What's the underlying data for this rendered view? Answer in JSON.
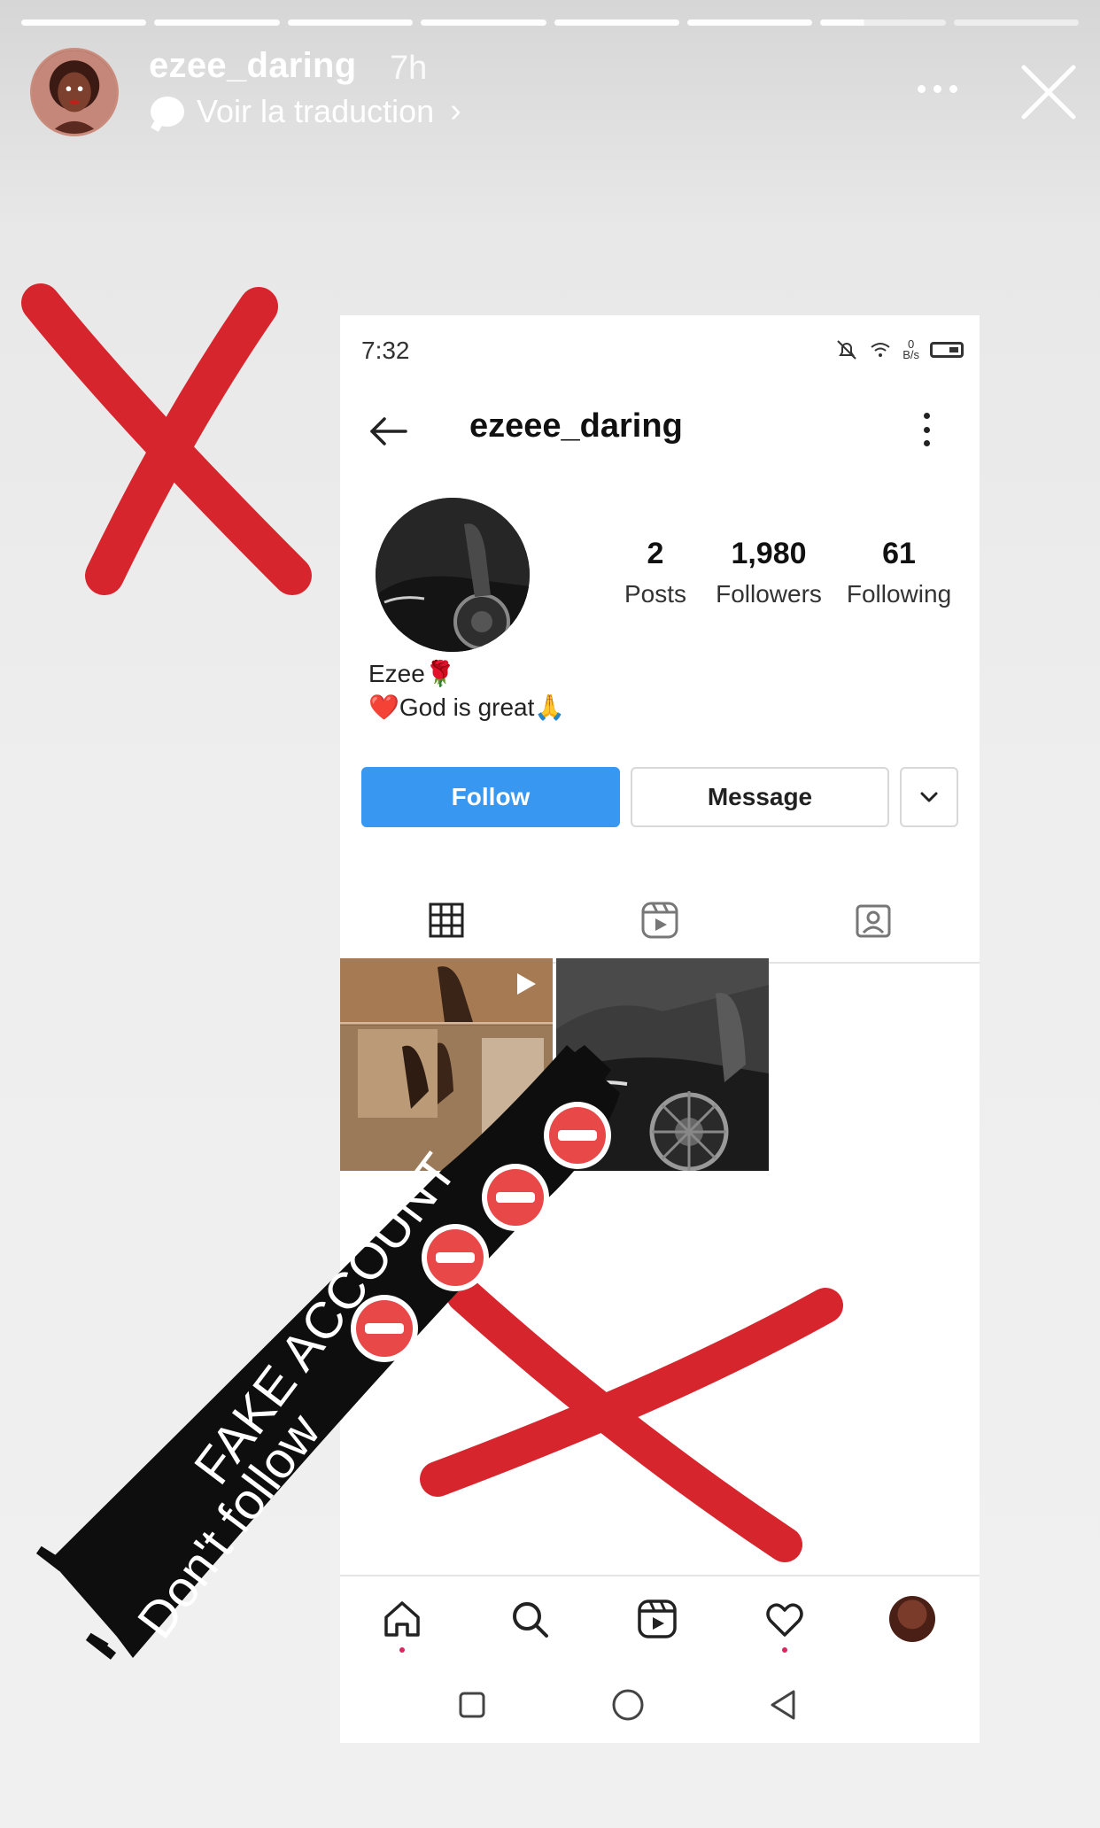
{
  "story": {
    "username": "ezee_daring",
    "time_ago": "7h",
    "translate_label": "Voir la traduction",
    "progress": {
      "segments": 8,
      "done": 6,
      "current_fraction": 0.35
    },
    "icons": {
      "avatar": "story-avatar",
      "more": "more-dots-icon",
      "close": "close-icon",
      "translate": "speech-bubble-icon",
      "chevron": "chevron-right-icon"
    }
  },
  "screenshot": {
    "status_time": "7:32",
    "status_network": "0\nB/s",
    "profile": {
      "username": "ezeee_daring",
      "stats": [
        {
          "value": "2",
          "label": "Posts"
        },
        {
          "value": "1,980",
          "label": "Followers"
        },
        {
          "value": "61",
          "label": "Following"
        }
      ],
      "bio_name": "Ezee",
      "bio_name_emoji": "🌹",
      "bio_heart": "❤️",
      "bio_text": "God is great",
      "bio_emoji": "🙏"
    },
    "buttons": {
      "follow": "Follow",
      "message": "Message"
    },
    "colors": {
      "follow_bg": "#3897f0",
      "cross_red": "#d7252d"
    }
  },
  "overlay": {
    "line1": "FAKE ACCOUNT",
    "line2": "Don't follow"
  }
}
